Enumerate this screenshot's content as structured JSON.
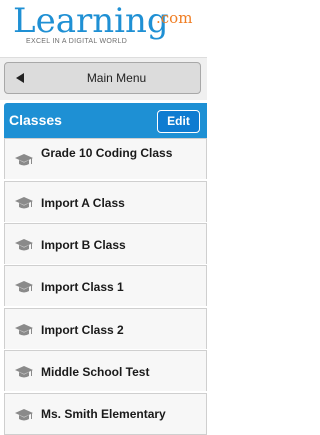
{
  "logo": {
    "main": "Learning",
    "suffix": ".com",
    "tagline": "EXCEL IN A DIGITAL WORLD",
    "main_color": "#1f90d4",
    "suffix_color": "#f07d22"
  },
  "nav": {
    "main_menu_label": "Main Menu",
    "back_icon": "left-triangle-icon"
  },
  "classes": {
    "title": "Classes",
    "edit_label": "Edit",
    "accent_color": "#1e90d4",
    "item_icon": "graduation-cap-icon",
    "items": [
      {
        "label": "Grade 10 Coding Class"
      },
      {
        "label": "Import A Class"
      },
      {
        "label": "Import B Class"
      },
      {
        "label": "Import Class 1"
      },
      {
        "label": "Import Class 2"
      },
      {
        "label": "Middle School Test"
      },
      {
        "label": "Ms. Smith Elementary"
      }
    ]
  }
}
